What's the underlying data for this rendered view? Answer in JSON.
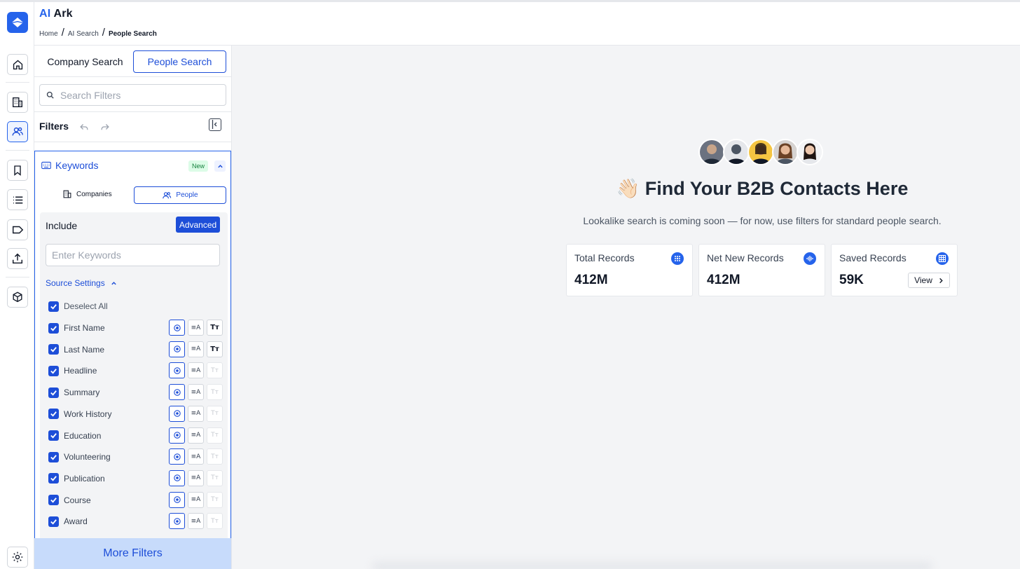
{
  "app": {
    "brand_ai": "AI",
    "brand_ark": "Ark"
  },
  "breadcrumb": {
    "home": "Home",
    "ai_search": "AI Search",
    "current": "People Search",
    "separator": "/"
  },
  "rail": {
    "items": [
      "home-icon",
      "building-icon",
      "people-icon",
      "bookmark-icon",
      "list-icon",
      "tag-icon",
      "upload-icon",
      "cube-icon",
      "settings-icon"
    ],
    "active": "people-icon"
  },
  "filters_panel": {
    "tabs": {
      "company": "Company Search",
      "people": "People Search"
    },
    "search_placeholder": "Search Filters",
    "filters_title": "Filters",
    "keywords": {
      "label": "Keywords",
      "badge": "New",
      "sub_tabs": {
        "companies": "Companies",
        "people": "People"
      },
      "include_label": "Include",
      "advanced_label": "Advanced",
      "input_placeholder": "Enter Keywords",
      "source_settings_label": "Source Settings",
      "deselect_all": "Deselect All",
      "sources": [
        {
          "label": "First Name",
          "case_active": true
        },
        {
          "label": "Last Name",
          "case_active": true
        },
        {
          "label": "Headline",
          "case_active": false
        },
        {
          "label": "Summary",
          "case_active": false
        },
        {
          "label": "Work History",
          "case_active": false
        },
        {
          "label": "Education",
          "case_active": false
        },
        {
          "label": "Volunteering",
          "case_active": false
        },
        {
          "label": "Publication",
          "case_active": false
        },
        {
          "label": "Course",
          "case_active": false
        },
        {
          "label": "Award",
          "case_active": false
        }
      ],
      "icon_labels": {
        "exact": "⦿",
        "fuzzy": "≡A",
        "case": "Tт"
      }
    },
    "more_filters": "More Filters"
  },
  "main": {
    "title": "👋🏻 Find Your B2B Contacts Here",
    "subtitle": "Lookalike search is coming soon — for now, use filters for standard people search.",
    "stats": [
      {
        "label": "Total Records",
        "value": "412M",
        "icon": "dots-icon"
      },
      {
        "label": "Net New Records",
        "value": "412M",
        "icon": "wave-icon"
      },
      {
        "label": "Saved Records",
        "value": "59K",
        "icon": "grid-icon",
        "action": "View"
      }
    ],
    "avatar_colors": [
      "#6b7280",
      "#374151",
      "#f5c542",
      "#a16207",
      "#d6d3d1"
    ]
  },
  "colors": {
    "accent": "#1d4ed8",
    "panel_bg": "#f3f4f6",
    "more_filters_bg": "#c7dbfb"
  }
}
